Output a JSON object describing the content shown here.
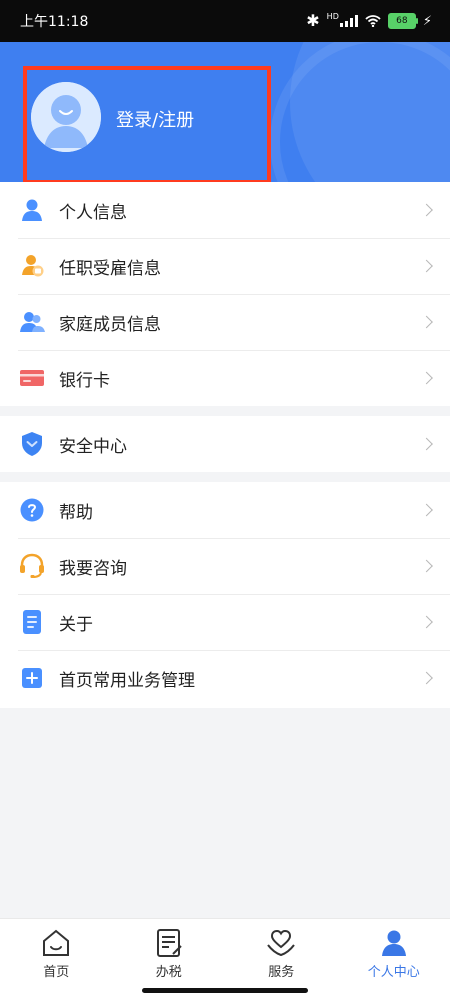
{
  "status_bar": {
    "time": "上午11:18",
    "network_type": "HD",
    "battery_percent": "68"
  },
  "profile": {
    "login_label": "登录/注册"
  },
  "menu_groups": [
    {
      "items": [
        {
          "label": "个人信息",
          "icon": "user-icon",
          "color": "#4a90ff"
        },
        {
          "label": "任职受雇信息",
          "icon": "employment-icon",
          "color": "#f3a32a"
        },
        {
          "label": "家庭成员信息",
          "icon": "family-icon",
          "color": "#4a90ff"
        },
        {
          "label": "银行卡",
          "icon": "bank-card-icon",
          "color": "#f05555"
        }
      ]
    },
    {
      "items": [
        {
          "label": "安全中心",
          "icon": "shield-icon",
          "color": "#3d84f3"
        }
      ]
    },
    {
      "items": [
        {
          "label": "帮助",
          "icon": "help-icon",
          "color": "#4a90ff"
        },
        {
          "label": "我要咨询",
          "icon": "headset-icon",
          "color": "#f3a32a"
        },
        {
          "label": "关于",
          "icon": "about-icon",
          "color": "#4a90ff"
        },
        {
          "label": "首页常用业务管理",
          "icon": "plus-icon",
          "color": "#4a90ff"
        }
      ]
    }
  ],
  "bottom_nav": {
    "items": [
      {
        "label": "首页",
        "icon": "home-icon",
        "active": false
      },
      {
        "label": "办税",
        "icon": "tax-icon",
        "active": false
      },
      {
        "label": "服务",
        "icon": "service-icon",
        "active": false
      },
      {
        "label": "个人中心",
        "icon": "profile-icon",
        "active": true
      }
    ]
  }
}
